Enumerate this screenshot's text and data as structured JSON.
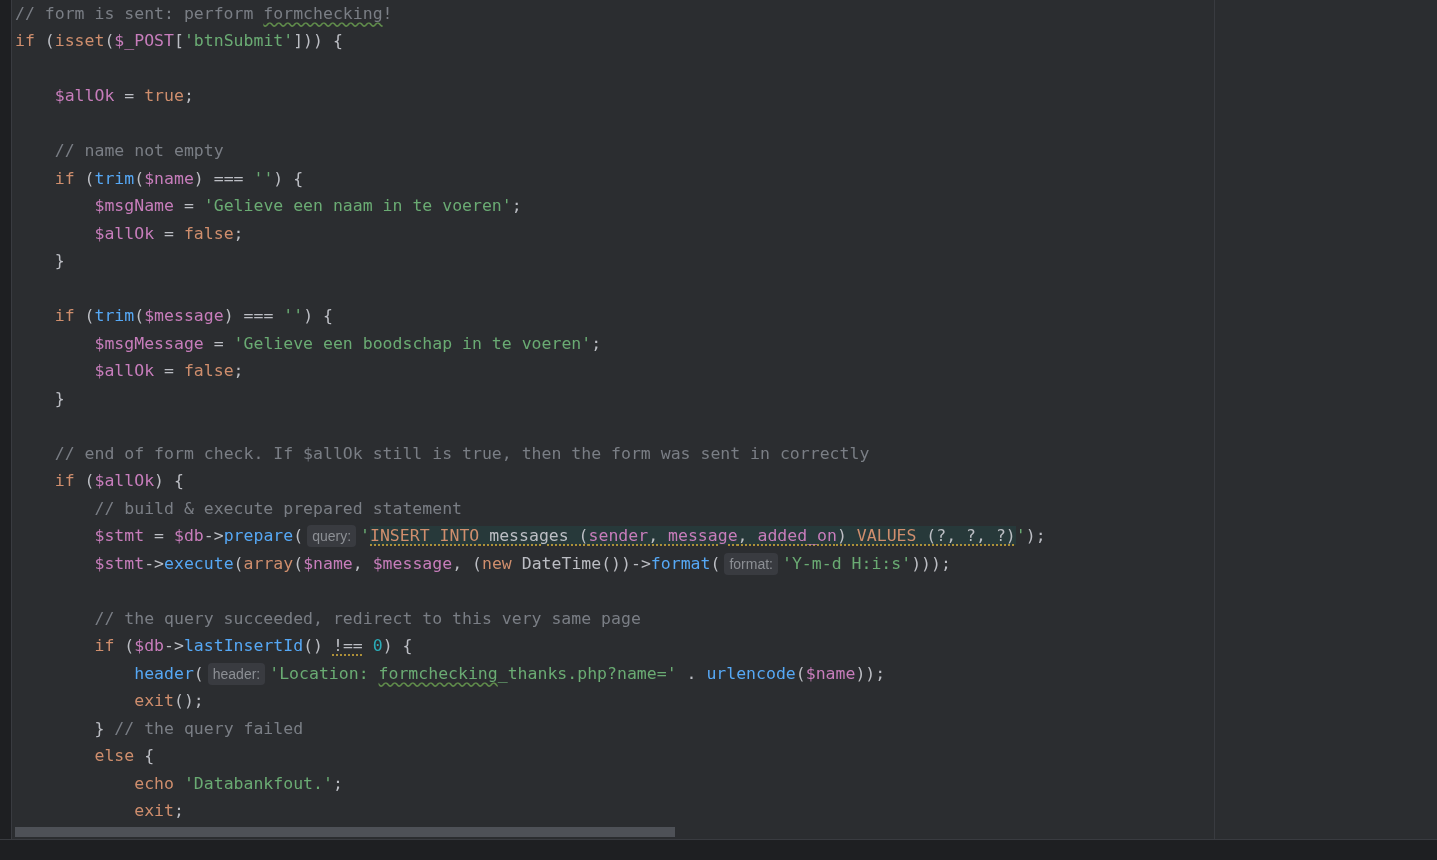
{
  "editor": {
    "lines": [
      {
        "kind": "code",
        "tokens": [
          {
            "kind": "cmt",
            "t": "// form is sent: perform "
          },
          {
            "kind": "cmt",
            "t": "formchecking",
            "typo": true
          },
          {
            "kind": "cmt",
            "t": "!"
          }
        ]
      },
      {
        "kind": "code",
        "tokens": [
          {
            "kind": "kw",
            "t": "if"
          },
          {
            "kind": "op",
            "t": " ("
          },
          {
            "kind": "kw",
            "t": "isset"
          },
          {
            "kind": "op",
            "t": "("
          },
          {
            "kind": "var",
            "t": "$_POST"
          },
          {
            "kind": "op",
            "t": "["
          },
          {
            "kind": "str",
            "t": "'btnSubmit'"
          },
          {
            "kind": "op",
            "t": "])) {"
          }
        ]
      },
      {
        "kind": "blank"
      },
      {
        "kind": "code",
        "tokens": [
          {
            "kind": "var",
            "t": "    $allOk"
          },
          {
            "kind": "op",
            "t": " = "
          },
          {
            "kind": "kw",
            "t": "true"
          },
          {
            "kind": "op",
            "t": ";"
          }
        ]
      },
      {
        "kind": "blank"
      },
      {
        "kind": "code",
        "tokens": [
          {
            "kind": "cmt",
            "t": "    // name not empty"
          }
        ]
      },
      {
        "kind": "code",
        "tokens": [
          {
            "kind": "kw",
            "t": "    if"
          },
          {
            "kind": "op",
            "t": " ("
          },
          {
            "kind": "fn",
            "t": "trim"
          },
          {
            "kind": "op",
            "t": "("
          },
          {
            "kind": "var",
            "t": "$name"
          },
          {
            "kind": "op",
            "t": ") === "
          },
          {
            "kind": "str",
            "t": "''"
          },
          {
            "kind": "op",
            "t": ") {"
          }
        ]
      },
      {
        "kind": "code",
        "tokens": [
          {
            "kind": "var",
            "t": "        $msgName"
          },
          {
            "kind": "op",
            "t": " = "
          },
          {
            "kind": "str",
            "t": "'Gelieve een naam in te voeren'"
          },
          {
            "kind": "op",
            "t": ";"
          }
        ]
      },
      {
        "kind": "code",
        "tokens": [
          {
            "kind": "var",
            "t": "        $allOk"
          },
          {
            "kind": "op",
            "t": " = "
          },
          {
            "kind": "kw",
            "t": "false"
          },
          {
            "kind": "op",
            "t": ";"
          }
        ]
      },
      {
        "kind": "code",
        "tokens": [
          {
            "kind": "op",
            "t": "    }"
          }
        ]
      },
      {
        "kind": "blank"
      },
      {
        "kind": "code",
        "tokens": [
          {
            "kind": "kw",
            "t": "    if"
          },
          {
            "kind": "op",
            "t": " ("
          },
          {
            "kind": "fn",
            "t": "trim"
          },
          {
            "kind": "op",
            "t": "("
          },
          {
            "kind": "var",
            "t": "$message"
          },
          {
            "kind": "op",
            "t": ") === "
          },
          {
            "kind": "str",
            "t": "''"
          },
          {
            "kind": "op",
            "t": ") {"
          }
        ]
      },
      {
        "kind": "code",
        "tokens": [
          {
            "kind": "var",
            "t": "        $msgMessage"
          },
          {
            "kind": "op",
            "t": " = "
          },
          {
            "kind": "str",
            "t": "'Gelieve een boodschap in te voeren'"
          },
          {
            "kind": "op",
            "t": ";"
          }
        ]
      },
      {
        "kind": "code",
        "tokens": [
          {
            "kind": "var",
            "t": "        $allOk"
          },
          {
            "kind": "op",
            "t": " = "
          },
          {
            "kind": "kw",
            "t": "false"
          },
          {
            "kind": "op",
            "t": ";"
          }
        ]
      },
      {
        "kind": "code",
        "tokens": [
          {
            "kind": "op",
            "t": "    }"
          }
        ]
      },
      {
        "kind": "blank"
      },
      {
        "kind": "code",
        "tokens": [
          {
            "kind": "cmt",
            "t": "    // end of form check. If $allOk still is true, then the form was sent in correctly"
          }
        ]
      },
      {
        "kind": "code",
        "tokens": [
          {
            "kind": "kw",
            "t": "    if"
          },
          {
            "kind": "op",
            "t": " ("
          },
          {
            "kind": "var",
            "t": "$allOk"
          },
          {
            "kind": "op",
            "t": ") {"
          }
        ]
      },
      {
        "kind": "code",
        "tokens": [
          {
            "kind": "cmt",
            "t": "        // build & execute prepared statement"
          }
        ]
      },
      {
        "kind": "code",
        "tokens": [
          {
            "kind": "var",
            "t": "        $stmt"
          },
          {
            "kind": "op",
            "t": " = "
          },
          {
            "kind": "var",
            "t": "$db"
          },
          {
            "kind": "op",
            "t": "->"
          },
          {
            "kind": "fn",
            "t": "prepare"
          },
          {
            "kind": "op",
            "t": "("
          },
          {
            "kind": "hint",
            "t": "query:"
          },
          {
            "kind": "str",
            "t": "'"
          },
          {
            "kind": "kw",
            "t": "INSERT INTO",
            "injected": true
          },
          {
            "kind": "op",
            "t": " messages (",
            "injected": true
          },
          {
            "kind": "var",
            "t": "sender",
            "injected": true
          },
          {
            "kind": "op",
            "t": ", ",
            "injected": true
          },
          {
            "kind": "var",
            "t": "message",
            "injected": true
          },
          {
            "kind": "op",
            "t": ", ",
            "injected": true
          },
          {
            "kind": "var",
            "t": "added_on",
            "injected": true
          },
          {
            "kind": "op",
            "t": ") ",
            "injected": true
          },
          {
            "kind": "kw",
            "t": "VALUES",
            "injected": true
          },
          {
            "kind": "op",
            "t": " (?, ?, ?)",
            "injected": true
          },
          {
            "kind": "str",
            "t": "'"
          },
          {
            "kind": "op",
            "t": ");"
          }
        ]
      },
      {
        "kind": "code",
        "tokens": [
          {
            "kind": "var",
            "t": "        $stmt"
          },
          {
            "kind": "op",
            "t": "->"
          },
          {
            "kind": "fn",
            "t": "execute"
          },
          {
            "kind": "op",
            "t": "("
          },
          {
            "kind": "kw",
            "t": "array"
          },
          {
            "kind": "op",
            "t": "("
          },
          {
            "kind": "var",
            "t": "$name"
          },
          {
            "kind": "op",
            "t": ", "
          },
          {
            "kind": "var",
            "t": "$message"
          },
          {
            "kind": "op",
            "t": ", ("
          },
          {
            "kind": "kw",
            "t": "new"
          },
          {
            "kind": "op",
            "t": " DateTime())->"
          },
          {
            "kind": "fn",
            "t": "format"
          },
          {
            "kind": "op",
            "t": "("
          },
          {
            "kind": "hint",
            "t": "format:"
          },
          {
            "kind": "str",
            "t": "'Y-m-d H:i:s'"
          },
          {
            "kind": "op",
            "t": ")));"
          }
        ]
      },
      {
        "kind": "blank"
      },
      {
        "kind": "code",
        "tokens": [
          {
            "kind": "cmt",
            "t": "        // the query succeeded, redirect to this very same page"
          }
        ]
      },
      {
        "kind": "code",
        "tokens": [
          {
            "kind": "kw",
            "t": "        if"
          },
          {
            "kind": "op",
            "t": " ("
          },
          {
            "kind": "var",
            "t": "$db"
          },
          {
            "kind": "op",
            "t": "->"
          },
          {
            "kind": "fn",
            "t": "lastInsertId"
          },
          {
            "kind": "op",
            "t": "() "
          },
          {
            "kind": "op",
            "t": "!==",
            "warning": true
          },
          {
            "kind": "num",
            "t": " 0"
          },
          {
            "kind": "op",
            "t": ") {"
          }
        ]
      },
      {
        "kind": "code",
        "tokens": [
          {
            "kind": "fn",
            "t": "            header"
          },
          {
            "kind": "op",
            "t": "("
          },
          {
            "kind": "hint",
            "t": "header:"
          },
          {
            "kind": "str",
            "t": "'Location: "
          },
          {
            "kind": "str",
            "t": "formchecking",
            "typo": true
          },
          {
            "kind": "str",
            "t": "_thanks.php?name='"
          },
          {
            "kind": "op",
            "t": " . "
          },
          {
            "kind": "fn",
            "t": "urlencode"
          },
          {
            "kind": "op",
            "t": "("
          },
          {
            "kind": "var",
            "t": "$name"
          },
          {
            "kind": "op",
            "t": "));"
          }
        ]
      },
      {
        "kind": "code",
        "tokens": [
          {
            "kind": "kw",
            "t": "            exit"
          },
          {
            "kind": "op",
            "t": "();"
          }
        ]
      },
      {
        "kind": "code",
        "tokens": [
          {
            "kind": "op",
            "t": "        } "
          },
          {
            "kind": "cmt",
            "t": "// the query failed"
          }
        ]
      },
      {
        "kind": "code",
        "tokens": [
          {
            "kind": "kw",
            "t": "        else"
          },
          {
            "kind": "op",
            "t": " {"
          }
        ]
      },
      {
        "kind": "code",
        "tokens": [
          {
            "kind": "kw",
            "t": "            echo "
          },
          {
            "kind": "str",
            "t": "'Databankfout.'"
          },
          {
            "kind": "op",
            "t": ";"
          }
        ]
      },
      {
        "kind": "code",
        "tokens": [
          {
            "kind": "kw",
            "t": "            exit"
          },
          {
            "kind": "op",
            "t": ";"
          }
        ]
      }
    ]
  }
}
